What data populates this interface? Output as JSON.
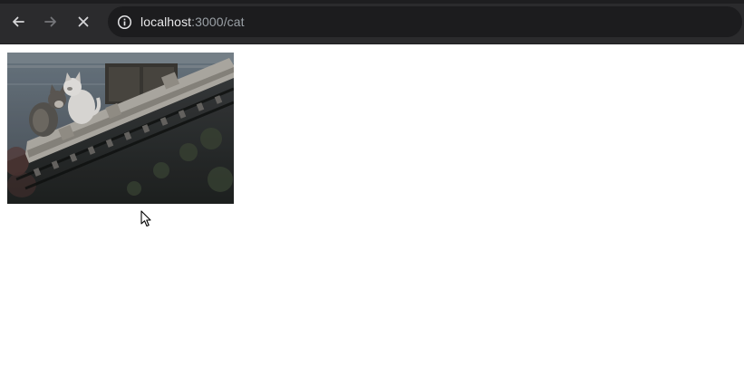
{
  "browser": {
    "url_host": "localhost",
    "url_path": ":3000/cat",
    "icons": {
      "back": "arrow-left-icon",
      "forward": "arrow-right-icon",
      "stop": "close-icon",
      "site_info": "info-icon"
    }
  },
  "page": {
    "image_subject": "photo"
  },
  "colors": {
    "chrome_bg": "#2b2b2d",
    "omnibox_bg": "#1c1c1e",
    "url_host": "#e8e8ea",
    "url_path": "#9aa0a6",
    "page_bg": "#ffffff"
  }
}
